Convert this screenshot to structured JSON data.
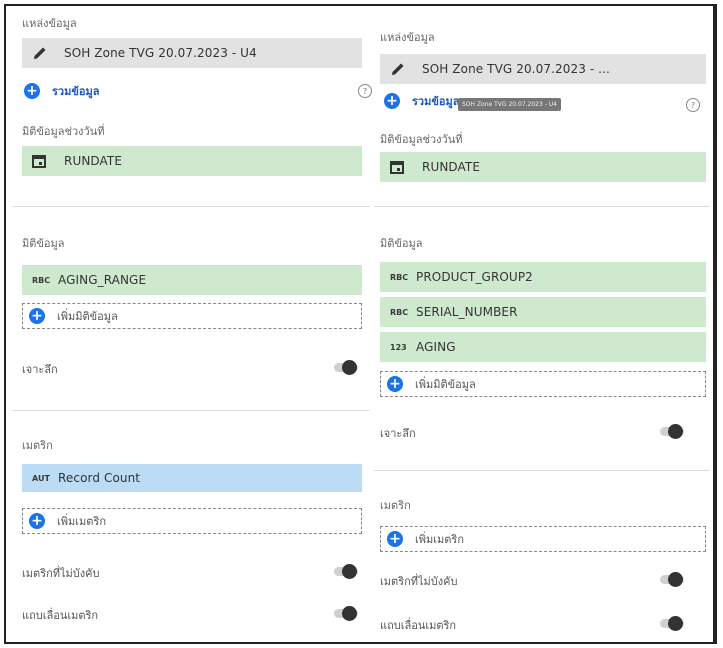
{
  "left": {
    "data_source_label": "แหล่งข้อมูล",
    "data_source_value": "SOH Zone TVG 20.07.2023 - U4",
    "blend_label": "รวมข้อมูล",
    "date_dimension_label": "มิติข้อมูลช่วงวันที่",
    "date_dimension_value": "RUNDATE",
    "dimension_label": "มิติข้อมูล",
    "dimensions": [
      {
        "type": "RBC",
        "name": "AGING_RANGE"
      }
    ],
    "add_dimension_label": "เพิ่มมิติข้อมูล",
    "drill_down_label": "เจาะลึก",
    "metric_label": "เมตริก",
    "metrics": [
      {
        "type": "AUT",
        "name": "Record Count"
      }
    ],
    "add_metric_label": "เพิ่มเมตริก",
    "optional_metrics_label": "เมตริกที่ไม่บังคับ",
    "metric_slider_label": "แถบเลื่อนเมตริก"
  },
  "right": {
    "data_source_label": "แหล่งข้อมูล",
    "data_source_value": "SOH Zone TVG 20.07.2023 - ...",
    "tooltip_text": "SOH Zone TVG 20.07.2023 - U4",
    "blend_label": "รวมข้อมูล",
    "date_dimension_label": "มิติข้อมูลช่วงวันที่",
    "date_dimension_value": "RUNDATE",
    "dimension_label": "มิติข้อมูล",
    "dimensions": [
      {
        "type": "RBC",
        "name": "PRODUCT_GROUP2"
      },
      {
        "type": "RBC",
        "name": "SERIAL_NUMBER"
      },
      {
        "type": "123",
        "name": "AGING"
      }
    ],
    "add_dimension_label": "เพิ่มมิติข้อมูล",
    "drill_down_label": "เจาะลึก",
    "metric_label": "เมตริก",
    "add_metric_label": "เพิ่มเมตริก",
    "optional_metrics_label": "เมตริกที่ไม่บังคับ",
    "metric_slider_label": "แถบเลื่อนเมตริก"
  },
  "help_glyph": "?",
  "plus_glyph": "+",
  "colors": {
    "accent": "#1a73e8",
    "dimension_chip": "#cfe9cf",
    "metric_chip": "#bcdcf5",
    "source_chip": "#e2e2e2"
  }
}
